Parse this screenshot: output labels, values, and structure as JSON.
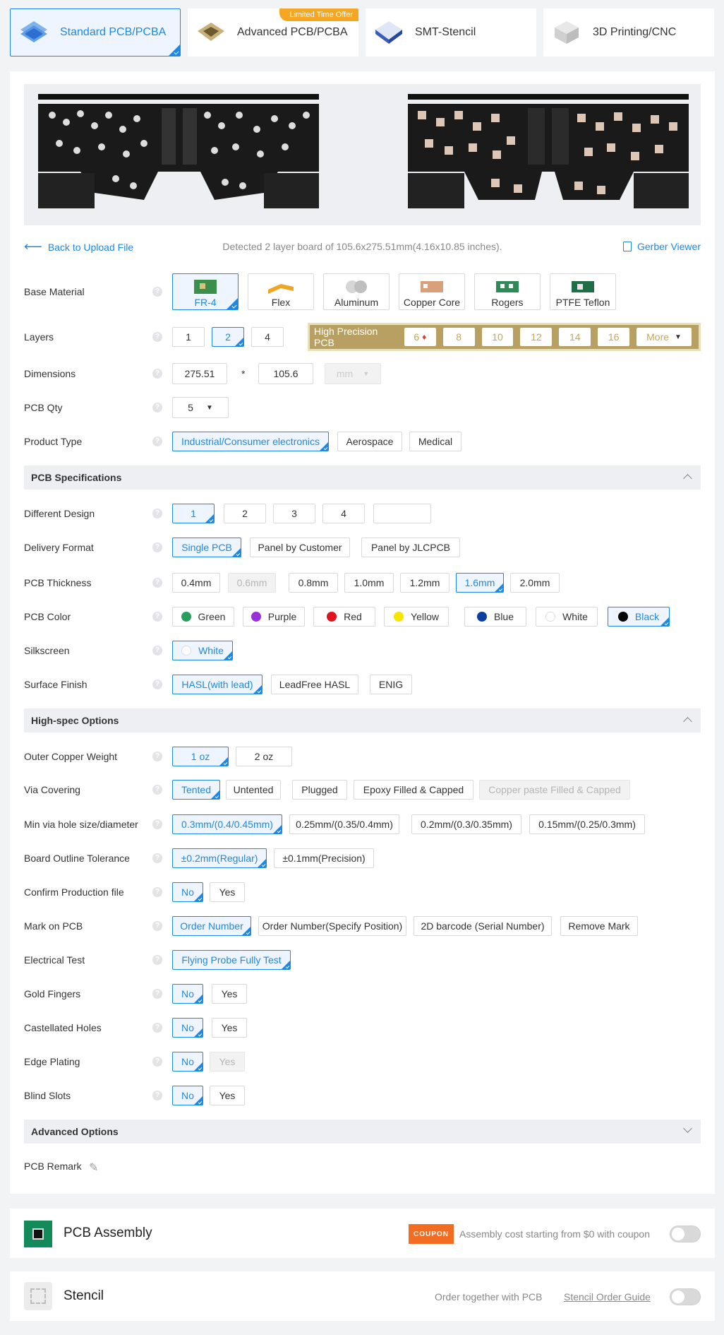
{
  "nav": {
    "tabs": [
      {
        "label": "Standard PCB/PCBA",
        "icon": "pcb-stack-icon"
      },
      {
        "label": "Advanced PCB/PCBA",
        "icon": "gold-pcb-icon",
        "badge": "Limited Time Offer"
      },
      {
        "label": "SMT-Stencil",
        "icon": "stencil-icon"
      },
      {
        "label": "3D Printing/CNC",
        "icon": "3d-cube-icon"
      }
    ],
    "active": 0
  },
  "upload": {
    "back_label": "Back to Upload File",
    "detected": "Detected 2 layer board of 105.6x275.51mm(4.16x10.85 inches).",
    "gerber_label": "Gerber Viewer"
  },
  "labels": {
    "base_material": "Base Material",
    "layers": "Layers",
    "dimensions": "Dimensions",
    "pcb_qty": "PCB Qty",
    "product_type": "Product Type",
    "different_design": "Different Design",
    "delivery_format": "Delivery Format",
    "pcb_thickness": "PCB Thickness",
    "pcb_color": "PCB Color",
    "silkscreen": "Silkscreen",
    "surface_finish": "Surface Finish",
    "outer_copper": "Outer Copper Weight",
    "via_covering": "Via Covering",
    "min_via": "Min via hole size/diameter",
    "outline_tol": "Board Outline Tolerance",
    "confirm_prod": "Confirm Production file",
    "mark_on_pcb": "Mark on PCB",
    "electrical_test": "Electrical Test",
    "gold_fingers": "Gold Fingers",
    "castellated": "Castellated Holes",
    "edge_plating": "Edge Plating",
    "blind_slots": "Blind Slots",
    "pcb_remark": "PCB Remark",
    "help": "?"
  },
  "base_material": [
    "FR-4",
    "Flex",
    "Aluminum",
    "Copper Core",
    "Rogers",
    "PTFE Teflon"
  ],
  "layers": {
    "options": [
      "1",
      "2",
      "4"
    ],
    "high_precision_label": "High Precision PCB",
    "high_precision": [
      "6",
      "8",
      "10",
      "12",
      "14",
      "16"
    ],
    "more": "More"
  },
  "dimensions": {
    "length": "275.51",
    "times": "*",
    "width": "105.6",
    "unit": "mm"
  },
  "qty": "5",
  "product_type": [
    "Industrial/Consumer electronics",
    "Aerospace",
    "Medical"
  ],
  "sections": {
    "pcb_specs": "PCB Specifications",
    "high_spec": "High-spec Options",
    "advanced": "Advanced Options"
  },
  "different_design": [
    "1",
    "2",
    "3",
    "4"
  ],
  "delivery_format": [
    "Single PCB",
    "Panel by Customer",
    "Panel by JLCPCB"
  ],
  "thickness": [
    "0.4mm",
    "0.6mm",
    "0.8mm",
    "1.0mm",
    "1.2mm",
    "1.6mm",
    "2.0mm"
  ],
  "colors": [
    {
      "name": "Green",
      "hex": "#2a9d5c"
    },
    {
      "name": "Purple",
      "hex": "#9b30d9"
    },
    {
      "name": "Red",
      "hex": "#e0141e"
    },
    {
      "name": "Yellow",
      "hex": "#f5e500"
    },
    {
      "name": "Blue",
      "hex": "#0d3fa0"
    },
    {
      "name": "White",
      "hex": "#ffffff"
    },
    {
      "name": "Black",
      "hex": "#000000"
    }
  ],
  "silkscreen": "White",
  "surface_finish": [
    "HASL(with lead)",
    "LeadFree HASL",
    "ENIG"
  ],
  "copper_weight": [
    "1 oz",
    "2 oz"
  ],
  "via_covering": [
    "Tented",
    "Untented",
    "Plugged",
    "Epoxy Filled & Capped",
    "Copper paste Filled & Capped"
  ],
  "min_via": [
    "0.3mm/(0.4/0.45mm)",
    "0.25mm/(0.35/0.4mm)",
    "0.2mm/(0.3/0.35mm)",
    "0.15mm/(0.25/0.3mm)"
  ],
  "outline_tol": [
    "±0.2mm(Regular)",
    "±0.1mm(Precision)"
  ],
  "confirm_prod": [
    "No",
    "Yes"
  ],
  "mark_on_pcb": [
    "Order Number",
    "Order Number(Specify Position)",
    "2D barcode (Serial Number)",
    "Remove Mark"
  ],
  "electrical_test": "Flying Probe Fully Test",
  "gold_fingers": [
    "No",
    "Yes"
  ],
  "castellated": [
    "No",
    "Yes"
  ],
  "edge_plating": [
    "No",
    "Yes"
  ],
  "blind_slots": [
    "No",
    "Yes"
  ],
  "assembly": {
    "title": "PCB Assembly",
    "coupon": "COUPON",
    "note": "Assembly cost starting from $0 with coupon"
  },
  "stencil": {
    "title": "Stencil",
    "note": "Order together with PCB",
    "guide": "Stencil Order Guide"
  },
  "accent": "#1e88e5"
}
